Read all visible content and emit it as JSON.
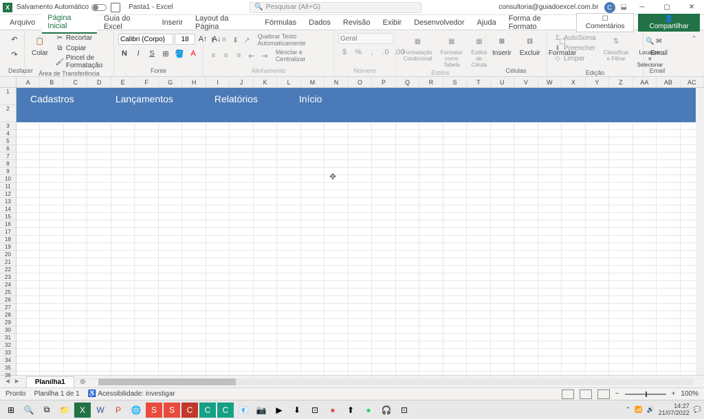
{
  "title_bar": {
    "autosave_label": "Salvamento Automático",
    "doc_title": "Pasta1 - Excel",
    "search_placeholder": "Pesquisar (Alt+G)",
    "user_email": "consultoria@guiadoexcel.com.br",
    "user_initial": "C"
  },
  "tabs": {
    "arquivo": "Arquivo",
    "pagina_inicial": "Página Inicial",
    "guia_excel": "Guia do Excel",
    "inserir": "Inserir",
    "layout": "Layout da Página",
    "formulas": "Fórmulas",
    "dados": "Dados",
    "revisao": "Revisão",
    "exibir": "Exibir",
    "desenvolvedor": "Desenvolvedor",
    "ajuda": "Ajuda",
    "forma_formato": "Forma de Formato",
    "comentarios": "Comentários",
    "compartilhar": "Compartilhar"
  },
  "ribbon": {
    "desfazer": {
      "label": "Desfazer"
    },
    "clipboard": {
      "colar": "Colar",
      "recortar": "Recortar",
      "copiar": "Copiar",
      "pincel": "Pincel de Formatação",
      "group_label": "Área de Transferência"
    },
    "fonte": {
      "font_name": "Calibri (Corpo)",
      "font_size": "18",
      "group_label": "Fonte"
    },
    "alinhamento": {
      "quebrar": "Quebrar Texto Automaticamente",
      "mesclar": "Mesclar e Centralizar",
      "group_label": "Alinhamento"
    },
    "numero": {
      "format": "Geral",
      "group_label": "Número"
    },
    "estilos": {
      "cond": "Formatação Condicional",
      "tabela": "Formatar como Tabela",
      "celula": "Estilos de Célula",
      "group_label": "Estilos"
    },
    "celulas": {
      "inserir": "Inserir",
      "excluir": "Excluir",
      "formatar": "Formatar",
      "group_label": "Células"
    },
    "edicao": {
      "autosoma": "AutoSoma",
      "preencher": "Preencher",
      "limpar": "Limpar",
      "classificar": "Classificar e Filtrar",
      "localizar": "Localizar e Selecionar",
      "group_label": "Edição"
    },
    "email": {
      "label": "Email",
      "group_label": "Email"
    }
  },
  "columns": [
    "A",
    "B",
    "C",
    "D",
    "E",
    "F",
    "G",
    "H",
    "I",
    "J",
    "K",
    "L",
    "M",
    "N",
    "O",
    "P",
    "Q",
    "R",
    "S",
    "T",
    "U",
    "V",
    "W",
    "X",
    "Y",
    "Z",
    "AA",
    "AB",
    "AC"
  ],
  "banner": {
    "cadastros": "Cadastros",
    "lancamentos": "Lançamentos",
    "relatorios": "Relatórios",
    "inicio": "Início"
  },
  "sheet": {
    "name": "Planilha1"
  },
  "status": {
    "pronto": "Pronto",
    "planilha": "Planilha 1 de 1",
    "acessibilidade": "Acessibilidade: investigar",
    "zoom": "100%"
  },
  "taskbar": {
    "time": "14:27",
    "date": "21/07/2022"
  }
}
